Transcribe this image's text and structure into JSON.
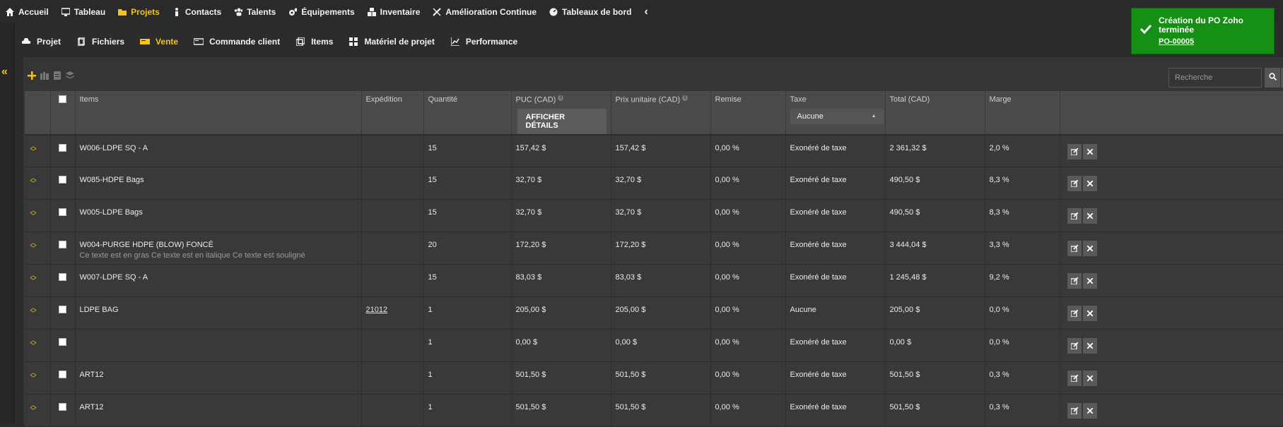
{
  "topnav": [
    {
      "label": "Accueil",
      "icon": "home-icon",
      "active": false
    },
    {
      "label": "Tableau",
      "icon": "monitor-icon",
      "active": false
    },
    {
      "label": "Projets",
      "icon": "folder-icon",
      "active": true
    },
    {
      "label": "Contacts",
      "icon": "person-icon",
      "active": false
    },
    {
      "label": "Talents",
      "icon": "users-icon",
      "active": false
    },
    {
      "label": "Équipements",
      "icon": "gears-icon",
      "active": false
    },
    {
      "label": "Inventaire",
      "icon": "boxes-icon",
      "active": false
    },
    {
      "label": "Amélioration Continue",
      "icon": "tools-icon",
      "active": false
    },
    {
      "label": "Tableaux de bord",
      "icon": "dashboard-icon",
      "active": false
    }
  ],
  "collapse_glyph": "‹",
  "subnav": [
    {
      "label": "Projet",
      "icon": "car-icon",
      "active": false
    },
    {
      "label": "Fichiers",
      "icon": "files-icon",
      "active": false
    },
    {
      "label": "Vente",
      "icon": "sale-icon",
      "active": true
    },
    {
      "label": "Commande client",
      "icon": "order-icon",
      "active": false
    },
    {
      "label": "Items",
      "icon": "copy-icon",
      "active": false
    },
    {
      "label": "Matériel de projet",
      "icon": "grid-icon",
      "active": false
    },
    {
      "label": "Performance",
      "icon": "chart-icon",
      "active": false
    }
  ],
  "search": {
    "placeholder": "Recherche"
  },
  "table": {
    "headers": {
      "items": "Items",
      "expedition": "Expédition",
      "quantite": "Quantité",
      "puc": "PUC (CAD)",
      "prix": "Prix unitaire (CAD)",
      "remise": "Remise",
      "taxe": "Taxe",
      "total": "Total (CAD)",
      "marge": "Marge"
    },
    "details_button": "AFFICHER DÉTAILS",
    "tax_filter": "Aucune",
    "rows": [
      {
        "item": "W006-LDPE SQ - A",
        "note": "",
        "expedition": "",
        "qty": "15",
        "puc": "157,42 $",
        "prix": "157,42 $",
        "remise": "0,00  %",
        "taxe": "Exonéré de taxe",
        "total": "2 361,32 $",
        "marge": "2,0  %"
      },
      {
        "item": "W085-HDPE Bags",
        "note": "",
        "expedition": "",
        "qty": "15",
        "puc": "32,70 $",
        "prix": "32,70 $",
        "remise": "0,00  %",
        "taxe": "Exonéré de taxe",
        "total": "490,50 $",
        "marge": "8,3  %"
      },
      {
        "item": "W005-LDPE Bags",
        "note": "",
        "expedition": "",
        "qty": "15",
        "puc": "32,70 $",
        "prix": "32,70 $",
        "remise": "0,00  %",
        "taxe": "Exonéré de taxe",
        "total": "490,50 $",
        "marge": "8,3  %"
      },
      {
        "item": "W004-PURGE HDPE (BLOW) FONCÉ",
        "note": "Ce texte est en gras Ce texte est en italique Ce texte est souligné",
        "expedition": "",
        "qty": "20",
        "puc": "172,20 $",
        "prix": "172,20 $",
        "remise": "0,00  %",
        "taxe": "Exonéré de taxe",
        "total": "3 444,04 $",
        "marge": "3,3  %"
      },
      {
        "item": "W007-LDPE SQ - A",
        "note": "",
        "expedition": "",
        "qty": "15",
        "puc": "83,03 $",
        "prix": "83,03 $",
        "remise": "0,00  %",
        "taxe": "Exonéré de taxe",
        "total": "1 245,48 $",
        "marge": "9,2  %"
      },
      {
        "item": "LDPE BAG",
        "note": "",
        "expedition": "21012",
        "qty": "1",
        "puc": "205,00 $",
        "prix": "205,00 $",
        "remise": "0,00  %",
        "taxe": "Aucune",
        "total": "205,00 $",
        "marge": "0,0  %"
      },
      {
        "item": "",
        "note": "",
        "expedition": "",
        "qty": "1",
        "puc": "0,00 $",
        "prix": "0,00 $",
        "remise": "0,00  %",
        "taxe": "Exonéré de taxe",
        "total": "0,00 $",
        "marge": "0,0  %"
      },
      {
        "item": "ART12",
        "note": "",
        "expedition": "",
        "qty": "1",
        "puc": "501,50 $",
        "prix": "501,50 $",
        "remise": "0,00  %",
        "taxe": "Exonéré de taxe",
        "total": "501,50 $",
        "marge": "0,3  %"
      },
      {
        "item": "ART12",
        "note": "",
        "expedition": "",
        "qty": "1",
        "puc": "501,50 $",
        "prix": "501,50 $",
        "remise": "0,00  %",
        "taxe": "Exonéré de taxe",
        "total": "501,50 $",
        "marge": "0,3  %"
      }
    ]
  },
  "toast": {
    "title": "Création du PO Zoho terminée",
    "code": "PO-00005"
  },
  "colors": {
    "accent": "#f5c518",
    "toast_green": "#159015",
    "header_bg": "#4a4a4a",
    "row_bg": "#393939"
  }
}
